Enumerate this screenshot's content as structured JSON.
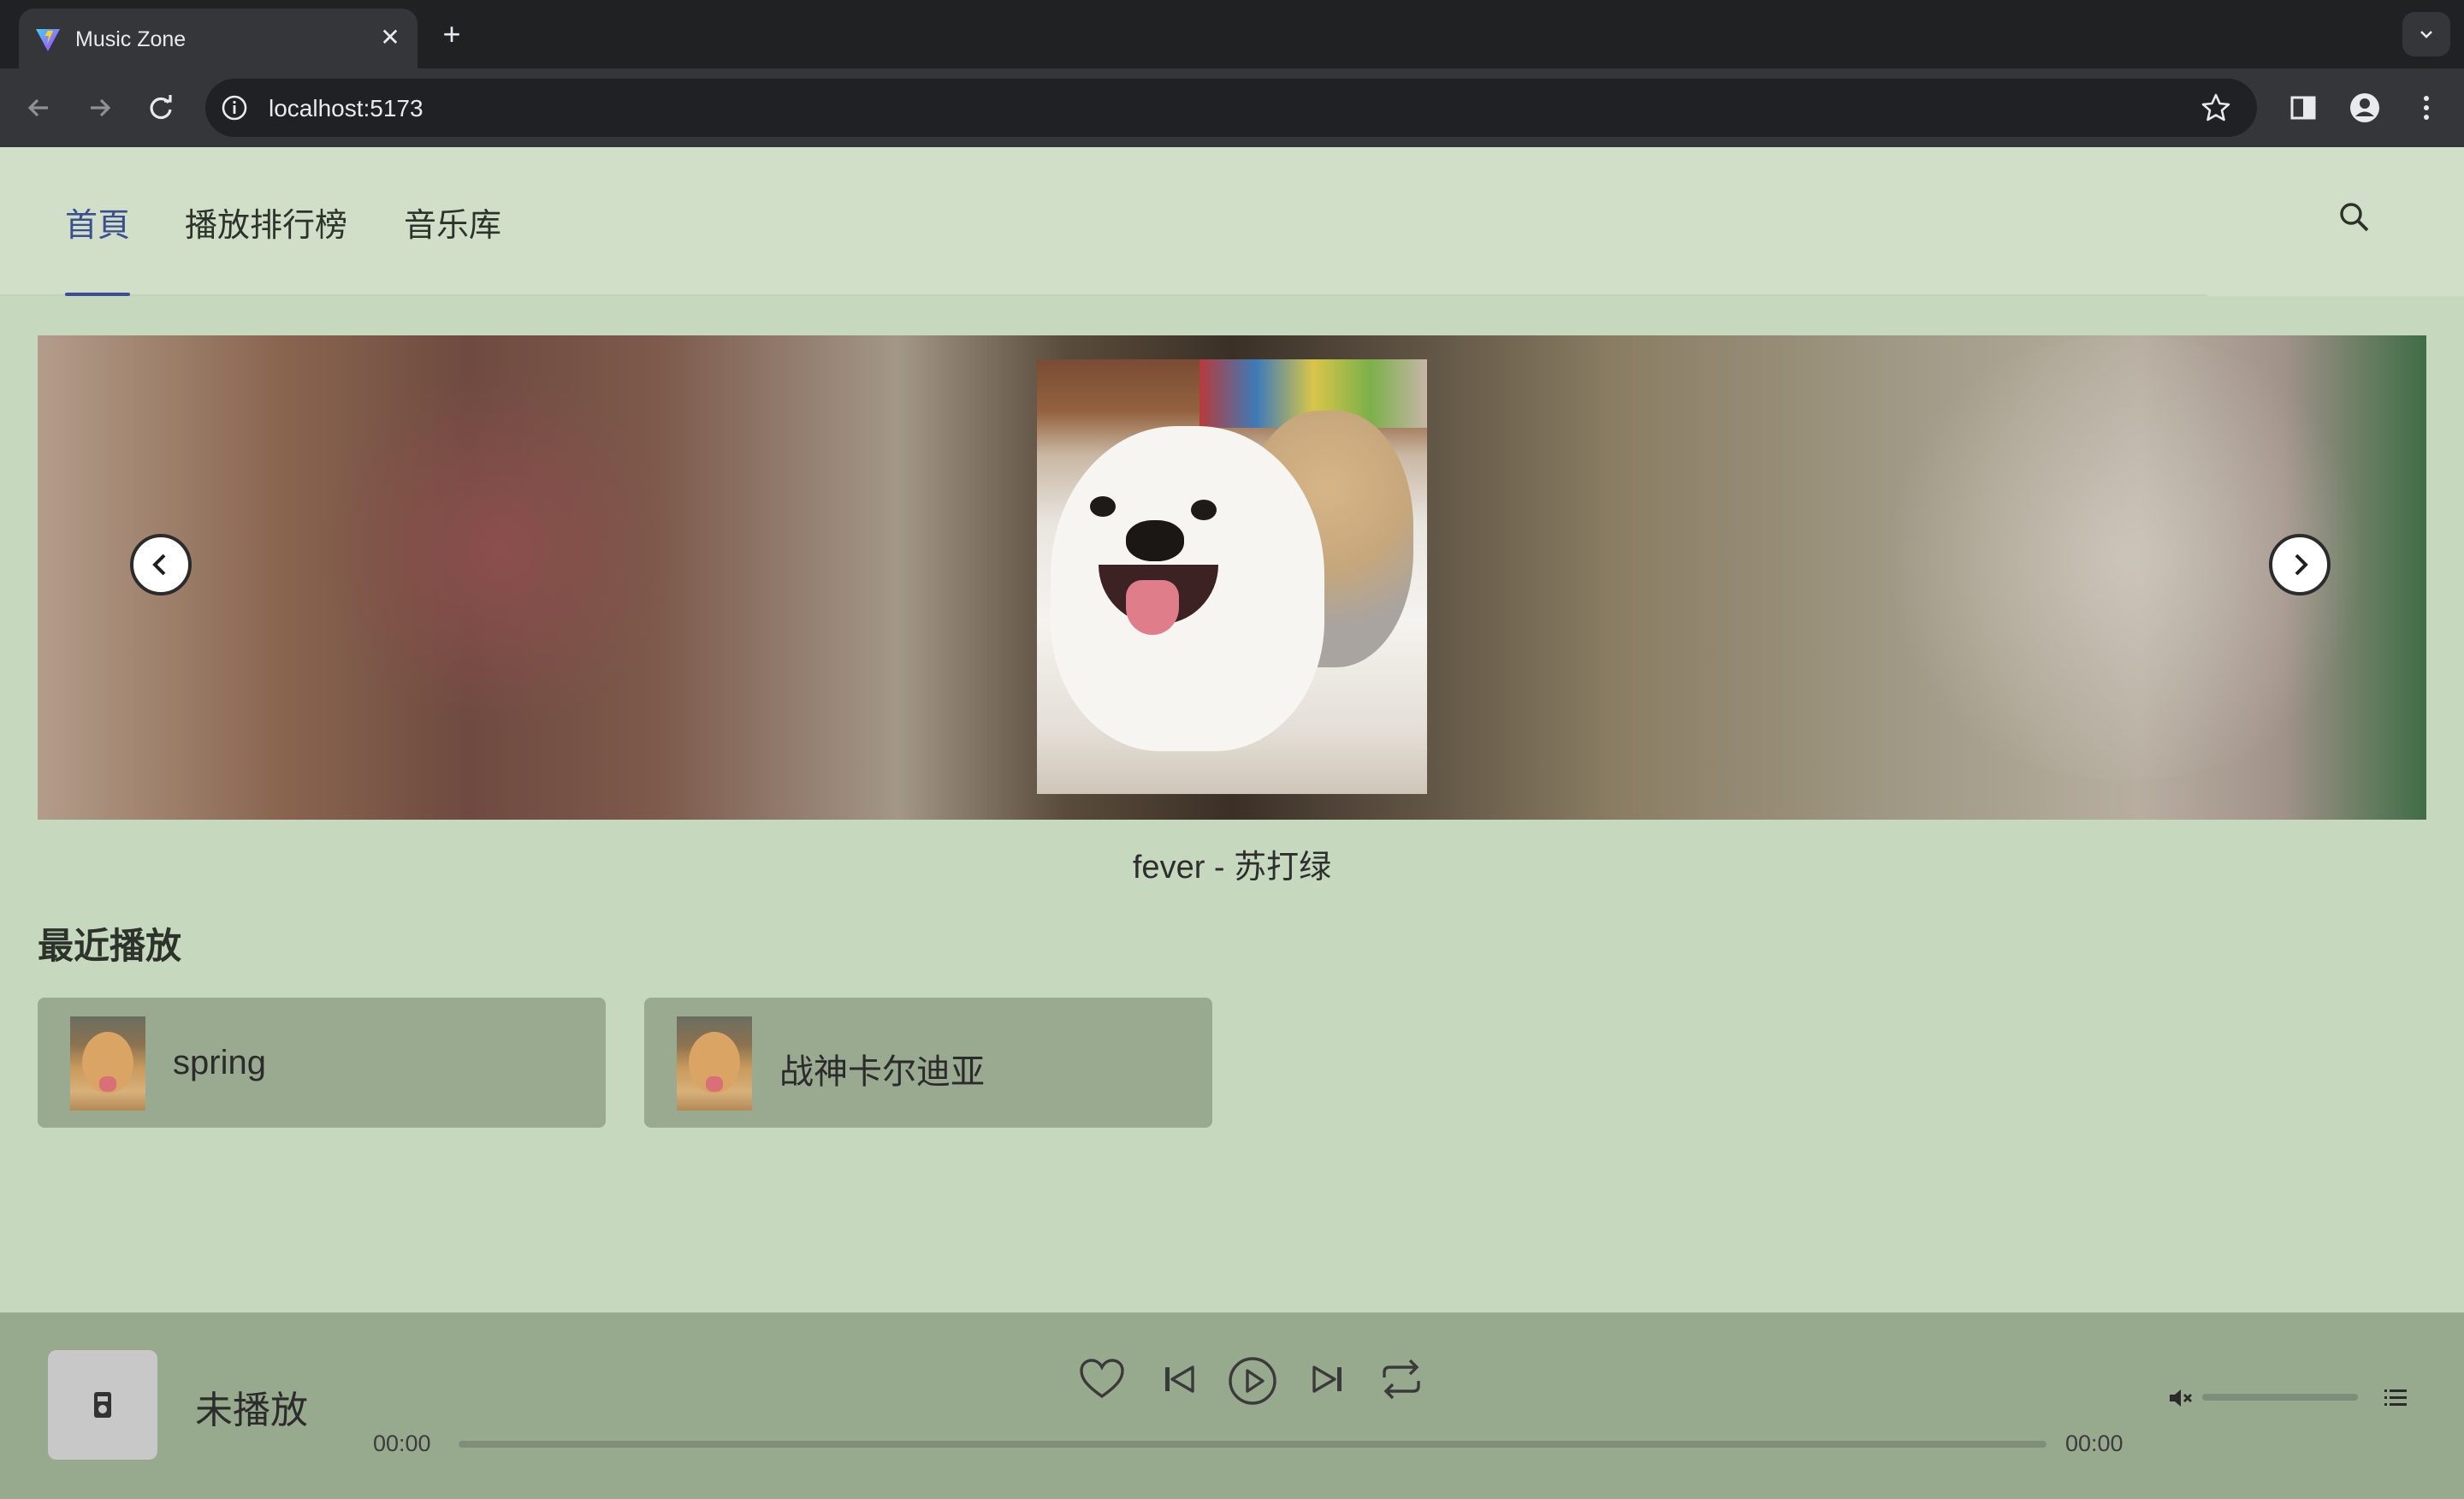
{
  "browser": {
    "tab_title": "Music Zone",
    "url": "localhost:5173"
  },
  "nav": {
    "tabs": [
      {
        "label": "首頁",
        "active": true
      },
      {
        "label": "播放排行榜",
        "active": false
      },
      {
        "label": "音乐库",
        "active": false
      }
    ],
    "search_icon": "search-icon"
  },
  "banner": {
    "caption": "fever - 苏打绿",
    "prev_icon": "chevron-left-icon",
    "next_icon": "chevron-right-icon"
  },
  "recent": {
    "title": "最近播放",
    "items": [
      {
        "name": "spring"
      },
      {
        "name": "战神卡尔迪亚"
      }
    ]
  },
  "player": {
    "title": "未播放",
    "current_time": "00:00",
    "total_time": "00:00",
    "progress": 0,
    "controls": [
      "heart-icon",
      "previous-icon",
      "play-icon",
      "next-icon",
      "repeat-icon"
    ],
    "volume_icon": "volume-muted-icon",
    "playlist_icon": "playlist-icon"
  },
  "colors": {
    "app_bg": "#c6d8be",
    "nav_bg": "#d1dfc9",
    "active_tab": "#3b4e8f",
    "card_bg": "#9aaa90",
    "player_bg": "#98aa8e"
  }
}
